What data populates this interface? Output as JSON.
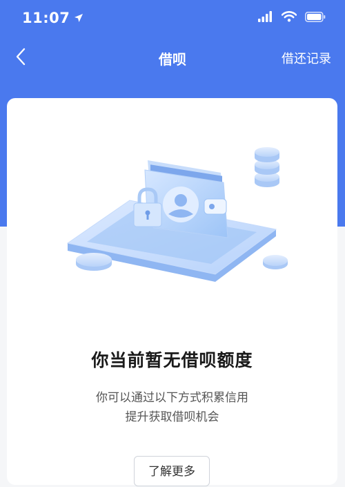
{
  "status_bar": {
    "time": "11:07"
  },
  "nav": {
    "title": "借呗",
    "right_link": "借还记录"
  },
  "empty_state": {
    "title": "你当前暂无借呗额度",
    "description_line1": "你可以通过以下方式积累信用",
    "description_line2": "提升获取借呗机会",
    "button_label": "了解更多"
  },
  "colors": {
    "header_blue": "#4a79ee",
    "card_bg": "#ffffff",
    "page_bg": "#f5f6f8"
  }
}
